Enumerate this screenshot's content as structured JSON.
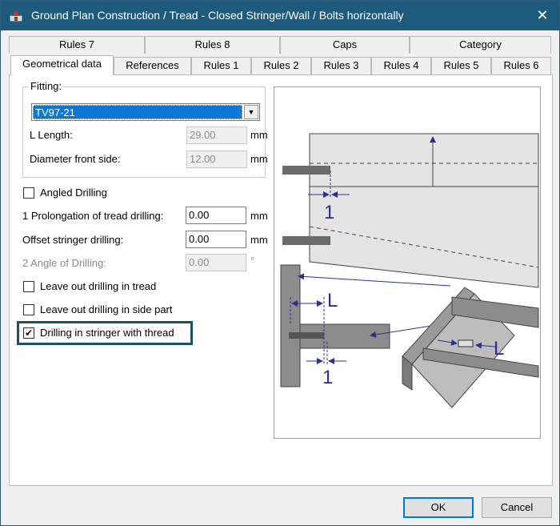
{
  "window": {
    "title": "Ground Plan Construction / Tread - Closed Stringer/Wall / Bolts horizontally",
    "close_glyph": "✕"
  },
  "tabs": {
    "row_back": [
      "Rules 7",
      "Rules 8",
      "Caps",
      "Category"
    ],
    "row_front": [
      "Geometrical data",
      "References",
      "Rules 1",
      "Rules 2",
      "Rules 3",
      "Rules 4",
      "Rules 5",
      "Rules 6"
    ],
    "active": "Geometrical data"
  },
  "fitting": {
    "group_label": "Fitting:",
    "selected": "TV97-21",
    "length_label": "L Length:",
    "length_value": "29.00",
    "length_unit": "mm",
    "diameter_label": "Diameter front side:",
    "diameter_value": "12.00",
    "diameter_unit": "mm"
  },
  "options": {
    "angled_drilling": {
      "label": "Angled Drilling",
      "checked": false
    },
    "prolongation_label": "1 Prolongation of tread drilling:",
    "prolongation_value": "0.00",
    "prolongation_unit": "mm",
    "offset_label": "Offset stringer drilling:",
    "offset_value": "0.00",
    "offset_unit": "mm",
    "angle_label": "2 Angle of Drilling:",
    "angle_value": "0.00",
    "angle_unit": "°",
    "leave_tread": {
      "label": "Leave out drilling in tread",
      "checked": false
    },
    "leave_side": {
      "label": "Leave out drilling in side part",
      "checked": false
    },
    "drill_thread": {
      "label": "Drilling in stringer with thread",
      "checked": true
    }
  },
  "diagram": {
    "label_1_top": "1",
    "label_1_bottom": "1",
    "label_L_left": "L",
    "label_L_right": "L"
  },
  "buttons": {
    "ok": "OK",
    "cancel": "Cancel"
  },
  "colors": {
    "titlebar": "#1e5a7c",
    "selection": "#0a78d7",
    "highlight": "#1e4f63",
    "diagram_arrow": "#2d2f8f"
  }
}
